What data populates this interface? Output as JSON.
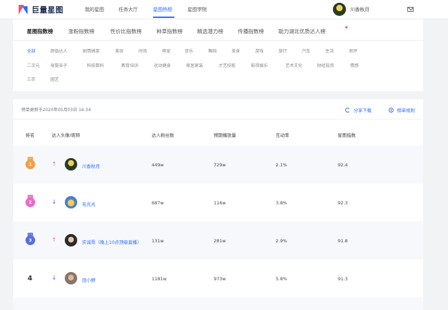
{
  "logo": {
    "text": "巨量星图"
  },
  "nav": [
    {
      "label": "我的星图",
      "active": false
    },
    {
      "label": "任务大厅",
      "active": false
    },
    {
      "label": "星图热榜",
      "active": true
    },
    {
      "label": "星图学院",
      "active": false
    }
  ],
  "user": {
    "name": "川香秋月"
  },
  "tabs": [
    {
      "label": "星图指数榜",
      "active": true
    },
    {
      "label": "涨粉指数榜",
      "active": false
    },
    {
      "label": "性价比指数榜",
      "active": false
    },
    {
      "label": "种草指数榜",
      "active": false
    },
    {
      "label": "精选潜力榜",
      "active": false
    },
    {
      "label": "传播指数榜",
      "active": false
    },
    {
      "label": "助力湖北优质达人榜",
      "active": false
    }
  ],
  "categories": [
    [
      "全部",
      "颜值达人",
      "剧情搞笑",
      "美妆",
      "时尚",
      "萌宠",
      "音乐",
      "舞蹈",
      "美食",
      "游戏",
      "旅行",
      "汽车",
      "生活",
      "测评"
    ],
    [
      "二次元",
      "母婴亲子",
      "科技数码",
      "教育培训",
      "运动健身",
      "家居家装",
      "才艺技能",
      "影视娱乐",
      "艺术文化",
      "财经投资",
      "情感"
    ],
    [
      "三农",
      "园艺"
    ]
  ],
  "active_category": "全部",
  "table": {
    "update_time": "榜单更新于2020年05月03日 16:34",
    "share_label": "分享下载",
    "rule_label": "榜单规则",
    "headers": [
      "排名",
      "达人头像/昵称",
      "达人粉丝数",
      "预期播放量",
      "互动率",
      "星图指数"
    ],
    "rows": [
      {
        "rank": "1",
        "trend": "up",
        "trend_symbol": "↑",
        "nickname": "川香秋月",
        "fans": "449w",
        "plays": "729w",
        "rate": "2.1%",
        "index": "92.4"
      },
      {
        "rank": "2",
        "trend": "down",
        "trend_symbol": "↓",
        "nickname": "毛光光",
        "fans": "687w",
        "plays": "116w",
        "rate": "3.8%",
        "index": "92.3"
      },
      {
        "rank": "3",
        "trend": "up",
        "trend_symbol": "↑",
        "nickname": "实诚哥（晚上10点顶级直播）",
        "fans": "131w",
        "plays": "281w",
        "rate": "2.9%",
        "index": "91.8"
      },
      {
        "rank": "4",
        "trend": "down",
        "trend_symbol": "↓",
        "nickname": "田小野",
        "fans": "1181w",
        "plays": "973w",
        "rate": "5.8%",
        "index": "91.3"
      }
    ]
  },
  "colors": {
    "accent": "#2f6bff",
    "up": "#f06a6a",
    "medal_gold": "#f0a04a",
    "medal_pink": "#e86cc8",
    "medal_blue": "#5b6fd9"
  }
}
